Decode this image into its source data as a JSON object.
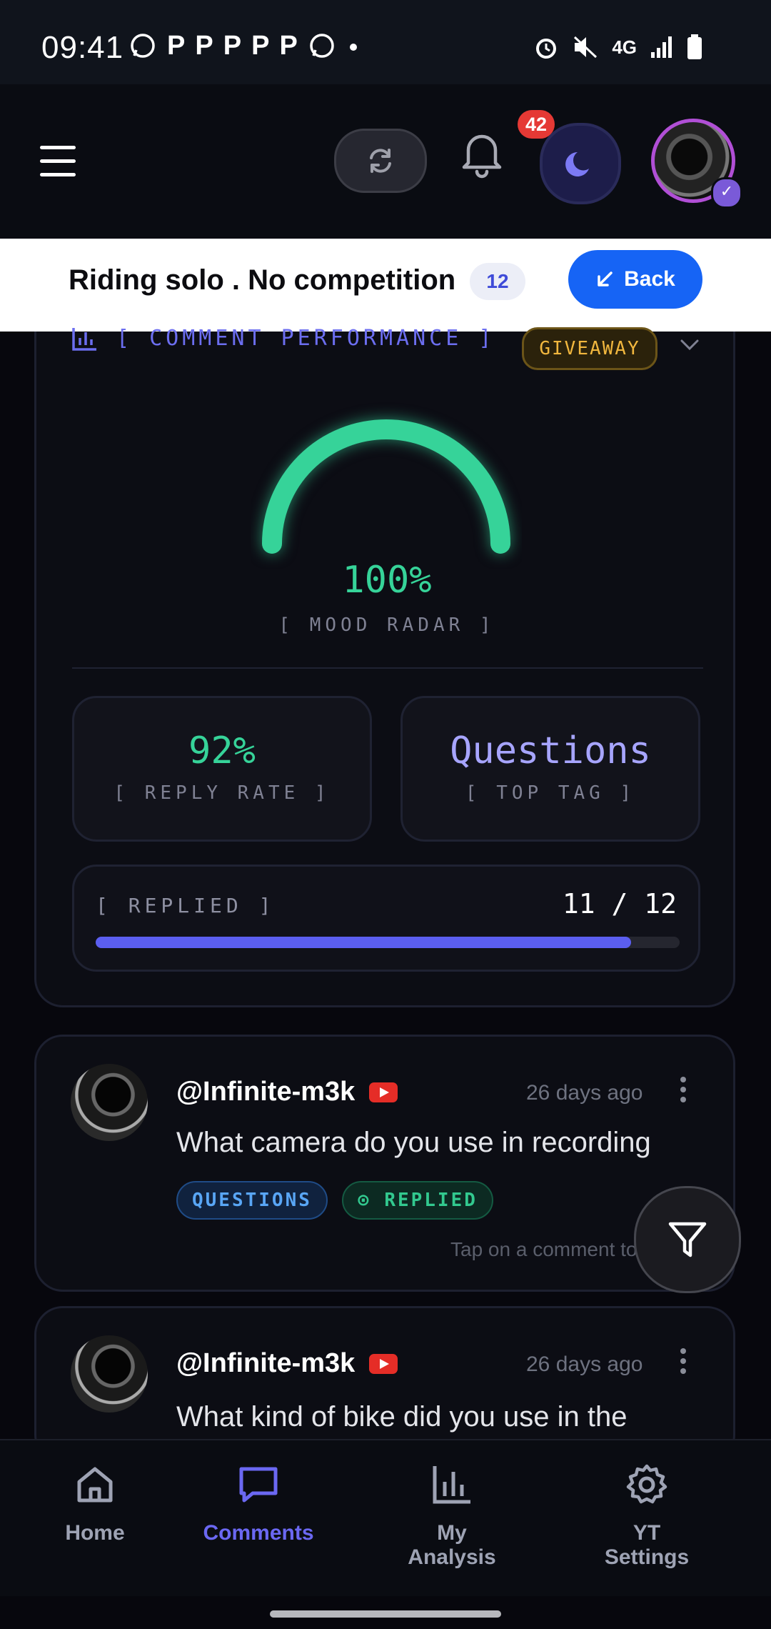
{
  "status_bar": {
    "time": "09:41",
    "network": "4G"
  },
  "header": {
    "notification_count": "42"
  },
  "title_row": {
    "title": "Riding solo . No competition",
    "count": "12",
    "back_label": "Back"
  },
  "performance": {
    "title": "[ COMMENT PERFORMANCE ]",
    "giveaway_label": "GIVEAWAY",
    "mood_value": "100%",
    "mood_label": "[ MOOD RADAR ]",
    "mood_fraction": 1.0,
    "reply_rate_value": "92%",
    "reply_rate_label": "[ REPLY RATE ]",
    "top_tag_value": "Questions",
    "top_tag_label": "[ TOP TAG ]",
    "replied_label": "[ REPLIED ]",
    "replied_value": "11 / 12",
    "replied_fraction": 0.9167
  },
  "comments": [
    {
      "author": "@Infinite-m3k",
      "time": "26 days ago",
      "text": "What camera do you use in recording",
      "tags": [
        "QUESTIONS",
        "REPLIED"
      ],
      "hint": "Tap on a comment to"
    },
    {
      "author": "@Infinite-m3k",
      "time": "26 days ago",
      "text": "What kind of bike did you use in the"
    }
  ],
  "nav": [
    {
      "label": "Home",
      "icon": "home-icon"
    },
    {
      "label": "Comments",
      "icon": "comment-icon",
      "active": true
    },
    {
      "label": "My Analysis",
      "icon": "bar-chart-icon"
    },
    {
      "label": "YT Settings",
      "icon": "gear-icon"
    }
  ],
  "colors": {
    "accent": "#6b68f2",
    "success": "#36d399",
    "back_button": "#1664f5",
    "badge": "#e53935"
  }
}
